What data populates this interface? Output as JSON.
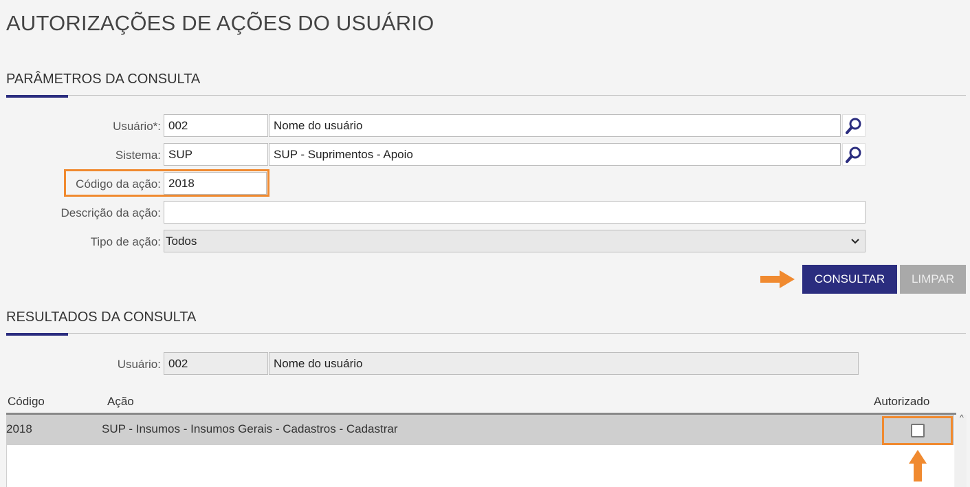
{
  "page_title": "AUTORIZAÇÕES DE AÇÕES DO USUÁRIO",
  "params": {
    "section_title": "PARÂMETROS DA CONSULTA",
    "usuario_label": "Usuário*:",
    "usuario_code": "002",
    "usuario_name": "Nome do usuário",
    "sistema_label": "Sistema:",
    "sistema_code": "SUP",
    "sistema_name": "SUP - Suprimentos - Apoio",
    "codigo_label": "Código da ação:",
    "codigo_value": "2018",
    "descricao_label": "Descrição da ação:",
    "descricao_value": "",
    "tipo_label": "Tipo de ação:",
    "tipo_value": "Todos",
    "consultar_label": "CONSULTAR",
    "limpar_label": "LIMPAR"
  },
  "results": {
    "section_title": "RESULTADOS DA CONSULTA",
    "usuario_label": "Usuário:",
    "usuario_code": "002",
    "usuario_name": "Nome do usuário",
    "columns": [
      "Código",
      "Ação",
      "Autorizado"
    ],
    "rows": [
      {
        "codigo": "2018",
        "acao": "SUP - Insumos - Insumos Gerais - Cadastros - Cadastrar",
        "autorizado": false
      }
    ]
  },
  "colors": {
    "accent": "#2b2d7f",
    "highlight": "#f08a30",
    "disabled": "#a9a9a9"
  },
  "icons": [
    "search-icon",
    "chevron-down-icon",
    "arrow-right-icon",
    "arrow-up-icon",
    "checkbox-icon"
  ]
}
